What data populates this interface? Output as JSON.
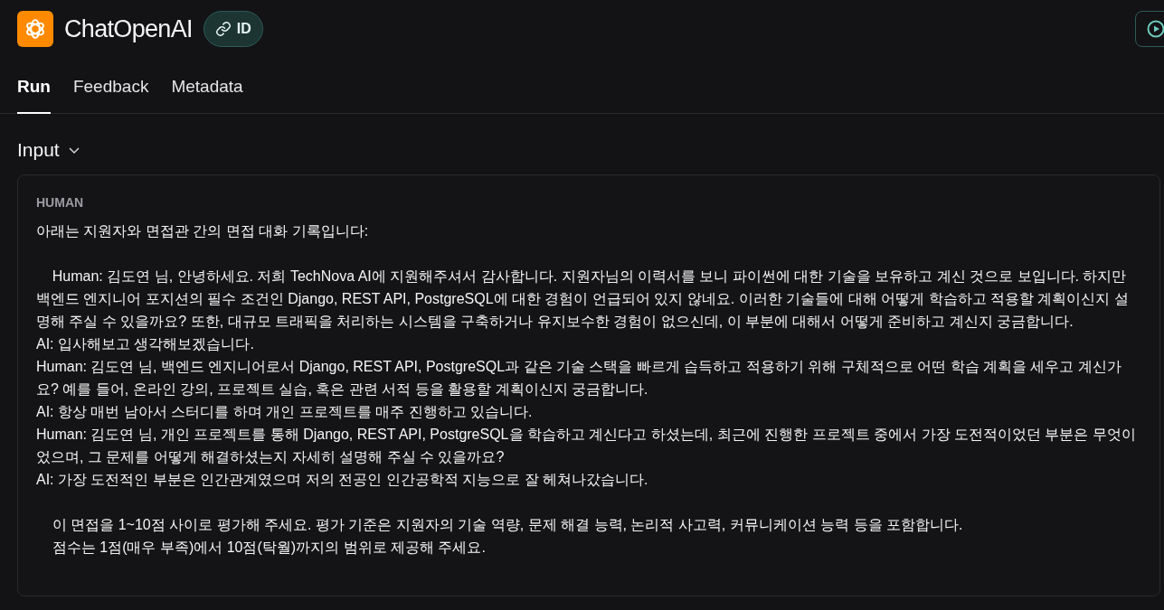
{
  "header": {
    "title": "ChatOpenAI",
    "id_badge": "ID"
  },
  "tabs": [
    {
      "label": "Run",
      "selected": true
    },
    {
      "label": "Feedback",
      "selected": false
    },
    {
      "label": "Metadata",
      "selected": false
    }
  ],
  "input_section": {
    "title": "Input",
    "expanded": true,
    "message": {
      "role": "HUMAN",
      "paragraphs": [
        [
          "아래는 지원자와 면접관 간의 면접 대화 기록입니다:"
        ],
        [
          "    Human: 김도연 님, 안녕하세요. 저희 TechNova AI에 지원해주셔서 감사합니다. 지원자님의 이력서를 보니 파이썬에 대한 기술을 보유하고 계신 것으로 보입니다. 하지만 백엔드 엔지니어 포지션의 필수 조건인 Django, REST API, PostgreSQL에 대한 경험이 언급되어 있지 않네요. 이러한 기술들에 대해 어떻게 학습하고 적용할 계획이신지 설명해 주실 수 있을까요? 또한, 대규모 트래픽을 처리하는 시스템을 구축하거나 유지보수한 경험이 없으신데, 이 부분에 대해서 어떻게 준비하고 계신지 궁금합니다.",
          "AI: 입사해보고 생각해보겠습니다.",
          "Human: 김도연 님, 백엔드 엔지니어로서 Django, REST API, PostgreSQL과 같은 기술 스택을 빠르게 습득하고 적용하기 위해 구체적으로 어떤 학습 계획을 세우고 계신가요? 예를 들어, 온라인 강의, 프로젝트 실습, 혹은 관련 서적 등을 활용할 계획이신지 궁금합니다.",
          "AI: 항상 매번 남아서 스터디를 하며 개인 프로젝트를 매주 진행하고 있습니다.",
          "Human: 김도연 님, 개인 프로젝트를 통해 Django, REST API, PostgreSQL을 학습하고 계신다고 하셨는데, 최근에 진행한 프로젝트 중에서 가장 도전적이었던 부분은 무엇이었으며, 그 문제를 어떻게 해결하셨는지 자세히 설명해 주실 수 있을까요?",
          "AI: 가장 도전적인 부분은 인간관계였으며 저의 전공인 인간공학적 지능으로 잘 헤쳐나갔습니다."
        ],
        [
          "    이 면접을 1~10점 사이로 평가해 주세요. 평가 기준은 지원자의 기술 역량, 문제 해결 능력, 논리적 사고력, 커뮤니케이션 능력 등을 포함합니다.",
          "    점수는 1점(매우 부족)에서 10점(탁월)까지의 범위로 제공해 주세요."
        ]
      ]
    }
  }
}
